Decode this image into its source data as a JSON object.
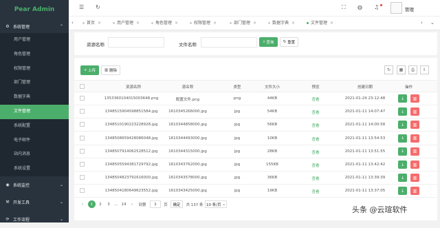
{
  "app": {
    "title": "Pear Admin"
  },
  "sidebar": {
    "groups": [
      {
        "label": "系统管理",
        "icon": "gear-icon",
        "expanded": true
      },
      {
        "label": "系统监控",
        "icon": "monitor-icon",
        "expanded": false
      },
      {
        "label": "开发工具",
        "icon": "wrench-icon",
        "expanded": false
      },
      {
        "label": "工作流程",
        "icon": "flow-icon",
        "expanded": false
      }
    ],
    "items": [
      {
        "label": "用户管理"
      },
      {
        "label": "角色管理"
      },
      {
        "label": "权限管理"
      },
      {
        "label": "部门管理"
      },
      {
        "label": "数据字典"
      },
      {
        "label": "文件管理",
        "active": true
      },
      {
        "label": "系统配置"
      },
      {
        "label": "电子邮件"
      },
      {
        "label": "站内消息"
      },
      {
        "label": "系统设置"
      }
    ]
  },
  "header": {
    "username": "管理"
  },
  "tabs": [
    {
      "label": "首页"
    },
    {
      "label": "用户管理"
    },
    {
      "label": "角色管理"
    },
    {
      "label": "权限管理"
    },
    {
      "label": "部门管理"
    },
    {
      "label": "数据字典"
    },
    {
      "label": "文件管理",
      "active": true
    }
  ],
  "search": {
    "field1_label": "资源名称",
    "field2_label": "文件名称",
    "query_label": "查询",
    "reset_label": "重置"
  },
  "toolbar": {
    "upload_label": "上传",
    "delete_label": "删除"
  },
  "table": {
    "columns": [
      "资源名称",
      "源名称",
      "类型",
      "文件大小",
      "预览",
      "创建日期",
      "操作"
    ],
    "rows": [
      [
        "1353360104015003648.png",
        "配置文件.png",
        "png",
        "44KB",
        "查看",
        "2021-01-24 23:12:48"
      ],
      [
        "1348515904598851584.jpg",
        "1610345266000.jpg",
        "jpg",
        "54KB",
        "查看",
        "2021-01-11 14:07:47"
      ],
      [
        "1348510190223228928.jpg",
        "1610344858000.jpg",
        "jpg",
        "56KB",
        "查看",
        "2021-01-11 14:00:58"
      ],
      [
        "1348508659428086048.jpg",
        "1610344493000.jpg",
        "jpg",
        "10KB",
        "查看",
        "2021-01-11 13:54:53"
      ],
      [
        "1348507914062528512.jpg",
        "1610344315000.jpg",
        "jpg",
        "28KB",
        "查看",
        "2021-01-11 13:51:55"
      ],
      [
        "1348505594381729792.jpg",
        "1610343762000.jpg",
        "jpg",
        "155KB",
        "查看",
        "2021-01-11 13:42:42"
      ],
      [
        "1348504823791616000.jpg",
        "1610343578000.jpg",
        "jpg",
        "36KB",
        "查看",
        "2021-01-11 13:39:39"
      ],
      [
        "1348504180649623552.jpg",
        "1610343425000.jpg",
        "jpg",
        "19KB",
        "查看",
        "2021-01-11 13:37:05"
      ]
    ]
  },
  "pagination": {
    "pages": [
      "1",
      "2",
      "3",
      "...",
      "14"
    ],
    "goto_label": "到第",
    "goto_value": "1",
    "page_unit": "页",
    "confirm_label": "确定",
    "total_label": "共 137 条",
    "page_size_label": "10 条/页"
  },
  "watermark": "头条 @云瑄软件",
  "colors": {
    "accent": "#4cae6b",
    "danger": "#f56c6c",
    "sidebar": "#28333e"
  }
}
